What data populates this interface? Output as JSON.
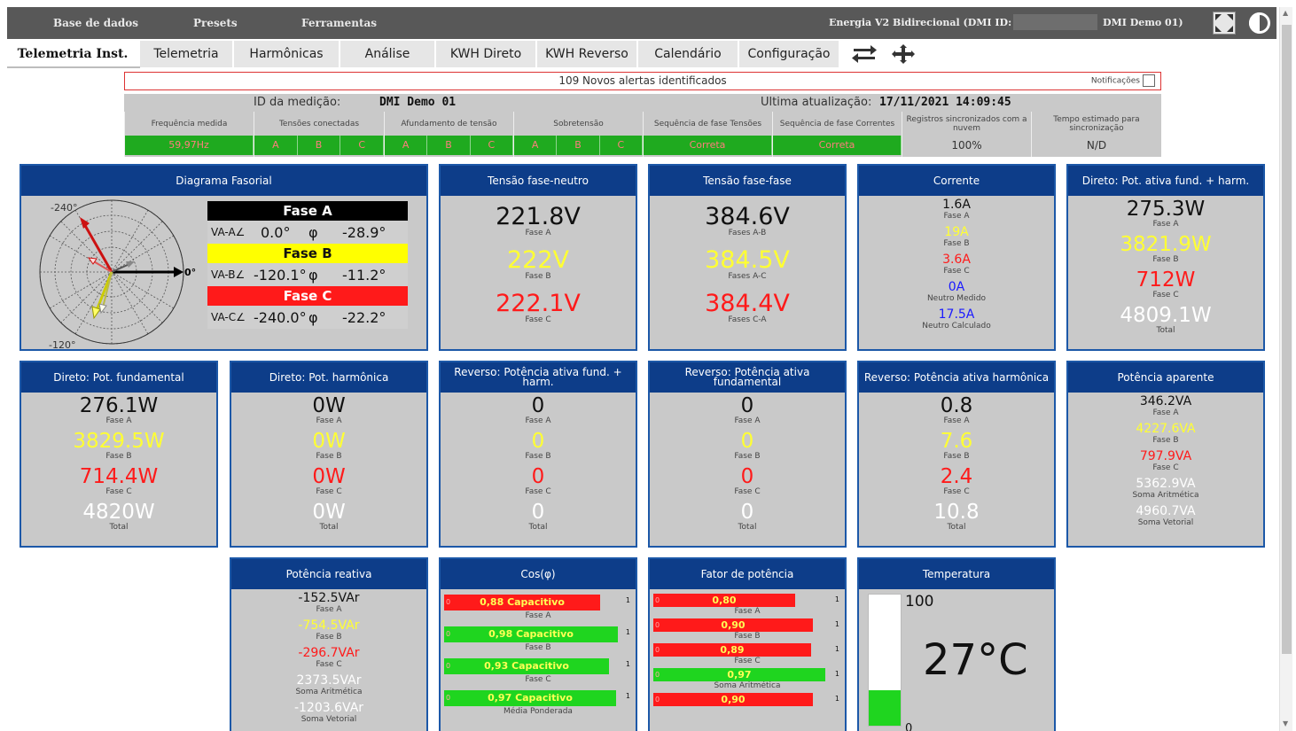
{
  "topbar": {
    "menu": [
      "Base de dados",
      "Presets",
      "Ferramentas"
    ],
    "device_prefix": "Energia V2 Bidirecional (DMI ID:",
    "device_suffix": "DMI Demo 01)"
  },
  "tabs": [
    "Telemetria Inst.",
    "Telemetria",
    "Harmônicas",
    "Análise",
    "KWH Direto",
    "KWH Reverso",
    "Calendário",
    "Configuração"
  ],
  "alert": {
    "text": "109 Novos alertas identificados",
    "notifications_label": "Notificações"
  },
  "info": {
    "id_label": "ID da medição:",
    "id_value": "DMI Demo 01",
    "update_label": "Ultima atualização:",
    "update_value": "17/11/2021 14:09:45",
    "columns": [
      {
        "label": "Frequência medida",
        "cells": [
          "59,97Hz"
        ]
      },
      {
        "label": "Tensões conectadas",
        "cells": [
          "A",
          "B",
          "C"
        ]
      },
      {
        "label": "Afundamento de tensão",
        "cells": [
          "A",
          "B",
          "C"
        ]
      },
      {
        "label": "Sobretensão",
        "cells": [
          "A",
          "B",
          "C"
        ]
      },
      {
        "label": "Sequência de fase Tensões",
        "cells": [
          "Correta"
        ]
      },
      {
        "label": "Sequência de fase Correntes",
        "cells": [
          "Correta"
        ]
      },
      {
        "label": "Registros sincronizados com a nuvem",
        "value": "100%"
      },
      {
        "label": "Tempo estimado para sincronização",
        "value": "N/D"
      }
    ]
  },
  "phasor": {
    "title": "Diagrama Fasorial",
    "axis_labels": [
      "-240°",
      "0°",
      "-120°"
    ],
    "phases": [
      {
        "name": "Fase A",
        "v_label": "VA-A∠",
        "angle": "0.0°",
        "phi_label": "φ",
        "phi": "-28.9°",
        "color": "#000000",
        "text_color": "#ffffff"
      },
      {
        "name": "Fase B",
        "v_label": "VA-B∠",
        "angle": "-120.1°",
        "phi_label": "φ",
        "phi": "-11.2°",
        "color": "#ffff00",
        "text_color": "#111111"
      },
      {
        "name": "Fase C",
        "v_label": "VA-C∠",
        "angle": "-240.0°",
        "phi_label": "φ",
        "phi": "-22.2°",
        "color": "#ff1a1a",
        "text_color": "#ffffff"
      }
    ]
  },
  "cards": {
    "tensao_fn": {
      "title": "Tensão fase-neutro",
      "rows": [
        [
          "221.8V",
          "Fase A"
        ],
        [
          "222V",
          "Fase B"
        ],
        [
          "222.1V",
          "Fase C"
        ]
      ]
    },
    "tensao_ff": {
      "title": "Tensão fase-fase",
      "rows": [
        [
          "384.6V",
          "Fases A-B"
        ],
        [
          "384.5V",
          "Fases A-C"
        ],
        [
          "384.4V",
          "Fases C-A"
        ]
      ]
    },
    "corrente": {
      "title": "Corrente",
      "rows": [
        [
          "1.6A",
          "Fase A"
        ],
        [
          "19A",
          "Fase B"
        ],
        [
          "3.6A",
          "Fase C"
        ],
        [
          "0A",
          "Neutro Medido"
        ],
        [
          "17.5A",
          "Neutro Calculado"
        ]
      ]
    },
    "dir_ativa": {
      "title": "Direto: Pot. ativa fund. + harm.",
      "rows": [
        [
          "275.3W",
          "Fase A"
        ],
        [
          "3821.9W",
          "Fase B"
        ],
        [
          "712W",
          "Fase C"
        ],
        [
          "4809.1W",
          "Total"
        ]
      ]
    },
    "dir_fund": {
      "title": "Direto: Pot. fundamental",
      "rows": [
        [
          "276.1W",
          "Fase A"
        ],
        [
          "3829.5W",
          "Fase B"
        ],
        [
          "714.4W",
          "Fase C"
        ],
        [
          "4820W",
          "Total"
        ]
      ]
    },
    "dir_harm": {
      "title": "Direto: Pot. harmônica",
      "rows": [
        [
          "0W",
          "Fase A"
        ],
        [
          "0W",
          "Fase B"
        ],
        [
          "0W",
          "Fase C"
        ],
        [
          "0W",
          "Total"
        ]
      ]
    },
    "rev_ativa": {
      "title": "Reverso: Potência ativa fund. + harm.",
      "rows": [
        [
          "0",
          "Fase A"
        ],
        [
          "0",
          "Fase B"
        ],
        [
          "0",
          "Fase C"
        ],
        [
          "0",
          "Total"
        ]
      ]
    },
    "rev_fund": {
      "title": "Reverso: Potência ativa fundamental",
      "rows": [
        [
          "0",
          "Fase A"
        ],
        [
          "0",
          "Fase B"
        ],
        [
          "0",
          "Fase C"
        ],
        [
          "0",
          "Total"
        ]
      ]
    },
    "rev_harm": {
      "title": "Reverso: Potência ativa harmônica",
      "rows": [
        [
          "0.8",
          "Fase A"
        ],
        [
          "7.6",
          "Fase B"
        ],
        [
          "2.4",
          "Fase C"
        ],
        [
          "10.8",
          "Total"
        ]
      ]
    },
    "aparente": {
      "title": "Potência aparente",
      "rows": [
        [
          "346.2VA",
          "Fase A"
        ],
        [
          "4227.6VA",
          "Fase B"
        ],
        [
          "797.9VA",
          "Fase C"
        ],
        [
          "5362.9VA",
          "Soma Aritmética"
        ],
        [
          "4960.7VA",
          "Soma Vetorial"
        ]
      ]
    },
    "reativa": {
      "title": "Potência reativa",
      "rows": [
        [
          "-152.5VAr",
          "Fase A"
        ],
        [
          "-754.5VAr",
          "Fase B"
        ],
        [
          "-296.7VAr",
          "Fase C"
        ],
        [
          "2373.5VAr",
          "Soma Aritmética"
        ],
        [
          "-1203.6VAr",
          "Soma Vetorial"
        ]
      ]
    },
    "cosphi": {
      "title": "Cos(φ)",
      "bar_min": "0",
      "bar_max": "1",
      "bars": [
        {
          "text": "0,88 Capacitivo",
          "value": 0.88,
          "color": "#ff1a1a",
          "label": "Fase A"
        },
        {
          "text": "0,98 Capacitivo",
          "value": 0.98,
          "color": "#1fd51f",
          "label": "Fase B"
        },
        {
          "text": "0,93 Capacitivo",
          "value": 0.93,
          "color": "#1fd51f",
          "label": "Fase C"
        },
        {
          "text": "0,97 Capacitivo",
          "value": 0.97,
          "color": "#1fd51f",
          "label": "Média Ponderada"
        }
      ]
    },
    "fator": {
      "title": "Fator de potência",
      "bar_min": "0",
      "bar_max": "1",
      "bars": [
        {
          "text": "0,80",
          "value": 0.8,
          "color": "#ff1a1a",
          "label": "Fase A"
        },
        {
          "text": "0,90",
          "value": 0.9,
          "color": "#ff1a1a",
          "label": "Fase B"
        },
        {
          "text": "0,89",
          "value": 0.89,
          "color": "#ff1a1a",
          "label": "Fase C"
        },
        {
          "text": "0,97",
          "value": 0.97,
          "color": "#1fd51f",
          "label": "Soma Aritmética"
        },
        {
          "text": "0,90",
          "value": 0.9,
          "color": "#ff1a1a",
          "label": ""
        }
      ]
    },
    "temperatura": {
      "title": "Temperatura",
      "max": "100",
      "min": "0",
      "value": "27°C",
      "level": 27
    }
  }
}
